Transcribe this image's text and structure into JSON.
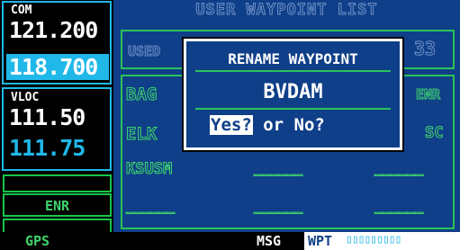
{
  "com": {
    "label": "COM",
    "standby": "121.200",
    "active": "118.700"
  },
  "vloc": {
    "label": "VLOC",
    "active": "111.50",
    "standby": "111.75"
  },
  "mode": {
    "label": "ENR"
  },
  "page": {
    "title": "USER WAYPOINT LIST",
    "used_label": "USED",
    "count": "33",
    "rows": [
      {
        "name": "BAG",
        "right": "ENR"
      },
      {
        "name": "ELK",
        "right": "SC"
      },
      {
        "name": "KSUSM",
        "c1": "______",
        "c2": "______"
      },
      {
        "name": "______",
        "c1": "______",
        "c2": "______"
      }
    ]
  },
  "dialog": {
    "title": "RENAME WAYPOINT",
    "name": "BVDAM",
    "yes": "Yes?",
    "or": " or ",
    "no": "No?"
  },
  "status": {
    "gps": "GPS",
    "msg": "MSG",
    "page_group": "WPT",
    "page_dots": "▯▯▯▯▯▯▯▯▯"
  },
  "colors": {
    "cyan": "#1fb8e8",
    "green": "#2ac25a",
    "navy": "#0f3f88",
    "white": "#ffffff"
  }
}
